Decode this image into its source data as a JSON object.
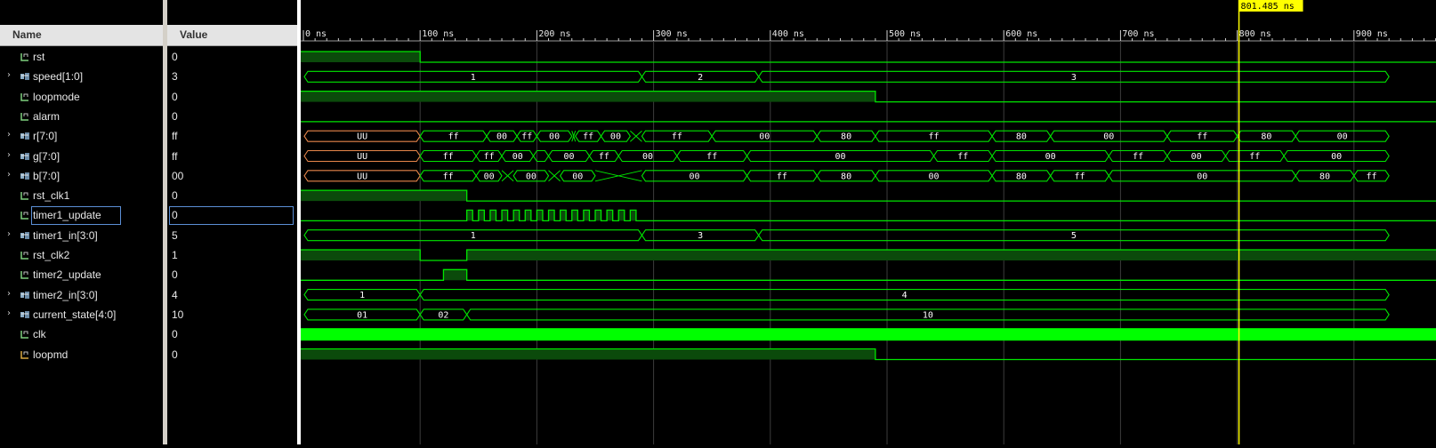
{
  "columns": {
    "name": "Name",
    "value": "Value"
  },
  "timeline": {
    "ticks": [
      "0 ns",
      "100 ns",
      "200 ns",
      "300 ns",
      "400 ns",
      "500 ns",
      "600 ns",
      "700 ns",
      "800 ns",
      "900 ns"
    ],
    "cursor_label": "801.485 ns",
    "cursor_time_ns": 801.485
  },
  "signals": [
    {
      "name": "rst",
      "value": "0",
      "kind": "bit",
      "expandable": false
    },
    {
      "name": "speed[1:0]",
      "value": "3",
      "kind": "bus",
      "expandable": true
    },
    {
      "name": "loopmode",
      "value": "0",
      "kind": "bit",
      "expandable": false
    },
    {
      "name": "alarm",
      "value": "0",
      "kind": "bit",
      "expandable": false
    },
    {
      "name": "r[7:0]",
      "value": "ff",
      "kind": "bus",
      "expandable": true
    },
    {
      "name": "g[7:0]",
      "value": "ff",
      "kind": "bus",
      "expandable": true
    },
    {
      "name": "b[7:0]",
      "value": "00",
      "kind": "bus",
      "expandable": true
    },
    {
      "name": "rst_clk1",
      "value": "0",
      "kind": "bit",
      "expandable": false
    },
    {
      "name": "timer1_update",
      "value": "0",
      "kind": "bit",
      "expandable": false,
      "selected": true
    },
    {
      "name": "timer1_in[3:0]",
      "value": "5",
      "kind": "bus",
      "expandable": true
    },
    {
      "name": "rst_clk2",
      "value": "1",
      "kind": "bit",
      "expandable": false
    },
    {
      "name": "timer2_update",
      "value": "0",
      "kind": "bit",
      "expandable": false
    },
    {
      "name": "timer2_in[3:0]",
      "value": "4",
      "kind": "bus",
      "expandable": true
    },
    {
      "name": "current_state[4:0]",
      "value": "10",
      "kind": "bus",
      "expandable": true
    },
    {
      "name": "clk",
      "value": "0",
      "kind": "bit",
      "expandable": false
    },
    {
      "name": "loopmd",
      "value": "0",
      "kind": "bit",
      "expandable": false,
      "alt_icon": true
    }
  ],
  "waves": [
    {
      "type": "bit",
      "edges": [
        [
          0,
          1
        ],
        [
          100,
          0
        ]
      ]
    },
    {
      "type": "bus",
      "segs": [
        [
          0,
          290,
          "1"
        ],
        [
          290,
          390,
          "2"
        ],
        [
          390,
          930,
          "3"
        ]
      ]
    },
    {
      "type": "bit",
      "edges": [
        [
          0,
          1
        ],
        [
          490,
          0
        ]
      ]
    },
    {
      "type": "bit",
      "edges": [
        [
          0,
          0
        ]
      ]
    },
    {
      "type": "bus",
      "segs": [
        [
          0,
          100,
          "UU",
          "u"
        ],
        [
          100,
          157,
          "ff"
        ],
        [
          157,
          183,
          "00"
        ],
        [
          183,
          200,
          "ff"
        ],
        [
          200,
          230,
          "00"
        ],
        [
          230,
          233,
          "",
          "g"
        ],
        [
          233,
          255,
          "ff"
        ],
        [
          255,
          280,
          "00"
        ],
        [
          280,
          290,
          "",
          "g"
        ],
        [
          290,
          350,
          "ff"
        ],
        [
          350,
          440,
          "00"
        ],
        [
          440,
          490,
          "80"
        ],
        [
          490,
          590,
          "ff"
        ],
        [
          590,
          640,
          "80"
        ],
        [
          640,
          740,
          "00"
        ],
        [
          740,
          800,
          "ff"
        ],
        [
          800,
          850,
          "80"
        ],
        [
          850,
          930,
          "00"
        ]
      ]
    },
    {
      "type": "bus",
      "segs": [
        [
          0,
          100,
          "UU",
          "u"
        ],
        [
          100,
          148,
          "ff"
        ],
        [
          148,
          170,
          "ff"
        ],
        [
          170,
          197,
          "00"
        ],
        [
          197,
          210,
          "ff"
        ],
        [
          210,
          245,
          "00"
        ],
        [
          245,
          270,
          "ff"
        ],
        [
          270,
          320,
          "00"
        ],
        [
          320,
          380,
          "ff"
        ],
        [
          380,
          540,
          "00"
        ],
        [
          540,
          590,
          "ff"
        ],
        [
          590,
          690,
          "00"
        ],
        [
          690,
          740,
          "ff"
        ],
        [
          740,
          790,
          "00"
        ],
        [
          790,
          840,
          "ff"
        ],
        [
          840,
          930,
          "00"
        ]
      ]
    },
    {
      "type": "bus",
      "segs": [
        [
          0,
          100,
          "UU",
          "u"
        ],
        [
          100,
          148,
          "ff"
        ],
        [
          148,
          170,
          "00"
        ],
        [
          170,
          180,
          "",
          "g"
        ],
        [
          180,
          210,
          "00"
        ],
        [
          210,
          220,
          "",
          "g"
        ],
        [
          220,
          250,
          "00"
        ],
        [
          250,
          290,
          "",
          "g"
        ],
        [
          290,
          380,
          "00"
        ],
        [
          380,
          440,
          "ff"
        ],
        [
          440,
          490,
          "80"
        ],
        [
          490,
          590,
          "00"
        ],
        [
          590,
          640,
          "80"
        ],
        [
          640,
          690,
          "ff"
        ],
        [
          690,
          850,
          "00"
        ],
        [
          850,
          900,
          "80"
        ],
        [
          900,
          930,
          "ff"
        ]
      ]
    },
    {
      "type": "bit",
      "edges": [
        [
          0,
          1
        ],
        [
          140,
          0
        ]
      ]
    },
    {
      "type": "clk",
      "from": 140,
      "to": 290,
      "period": 10
    },
    {
      "type": "bus",
      "segs": [
        [
          0,
          290,
          "1"
        ],
        [
          290,
          390,
          "3"
        ],
        [
          390,
          930,
          "5"
        ]
      ]
    },
    {
      "type": "bit",
      "edges": [
        [
          0,
          1
        ],
        [
          100,
          0
        ],
        [
          140,
          1
        ]
      ]
    },
    {
      "type": "bit",
      "edges": [
        [
          0,
          0
        ],
        [
          120,
          1
        ],
        [
          140,
          0
        ]
      ]
    },
    {
      "type": "bus",
      "segs": [
        [
          0,
          100,
          "1"
        ],
        [
          100,
          930,
          "4"
        ]
      ]
    },
    {
      "type": "bus",
      "segs": [
        [
          0,
          100,
          "01"
        ],
        [
          100,
          140,
          "02"
        ],
        [
          140,
          930,
          "10"
        ]
      ]
    },
    {
      "type": "solid"
    },
    {
      "type": "bit",
      "edges": [
        [
          0,
          1
        ],
        [
          490,
          0
        ]
      ]
    }
  ],
  "colors": {
    "wave": "#00e600",
    "wave_fill": "#0b4a0b",
    "bright_fill": "#00ff00",
    "undefined": "#e8864a",
    "grid": "#3c3c3c",
    "cursor": "#ffff00",
    "timer1_pulses": "#00e600"
  }
}
